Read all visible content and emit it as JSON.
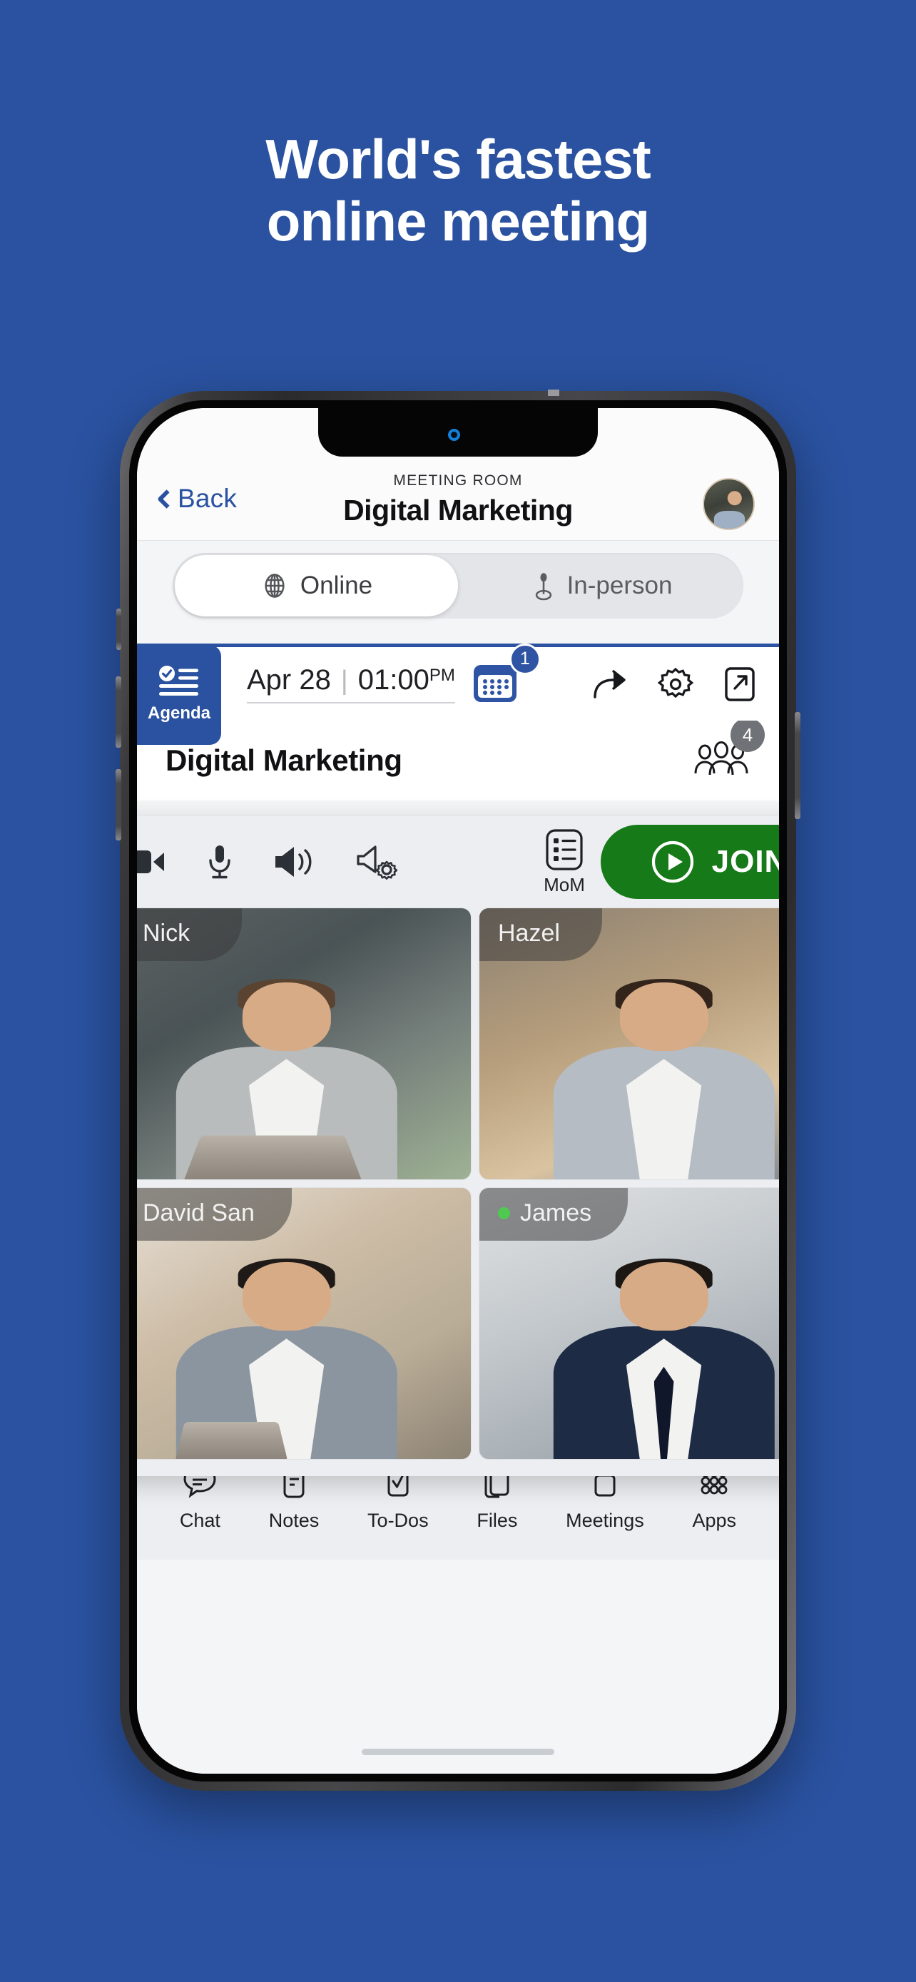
{
  "theme": {
    "background": "#2a52a0",
    "brand_blue": "#2a52a0",
    "join_green": "#167a18",
    "online_dot": "#4fc94f",
    "badge_grey": "#6f7277"
  },
  "promo": {
    "headline_line1": "World's fastest",
    "headline_line2": "online meeting"
  },
  "app": {
    "header": {
      "back_label": "Back",
      "kicker": "MEETING ROOM",
      "title": "Digital Marketing",
      "avatar_name": "avatar"
    },
    "segmented": {
      "options": [
        {
          "label": "Online",
          "icon": "globe-icon",
          "active": true
        },
        {
          "label": "In-person",
          "icon": "map-pin-icon",
          "active": false
        }
      ]
    },
    "agenda": {
      "tab_label": "Agenda",
      "date": "Apr 28",
      "separator": "|",
      "time": "01:00",
      "ampm": "PM",
      "calendar_badge": "1",
      "actions": [
        {
          "name": "share-icon"
        },
        {
          "name": "gear-icon"
        },
        {
          "name": "expand-icon"
        }
      ]
    },
    "meeting": {
      "title": "Digital Marketing",
      "participants_badge": "4"
    },
    "call_card": {
      "controls": [
        {
          "name": "video-camera-icon"
        },
        {
          "name": "microphone-icon"
        },
        {
          "name": "speaker-icon"
        },
        {
          "name": "speaker-settings-icon"
        }
      ],
      "mom_label": "MoM",
      "join_label": "JOIN",
      "tiles": [
        {
          "name": "Nick",
          "online": true
        },
        {
          "name": "Hazel",
          "online": false
        },
        {
          "name": "David San",
          "online": true
        },
        {
          "name": "James",
          "online": true
        }
      ]
    },
    "bottom_nav": [
      {
        "label": "Chat",
        "icon": "chat-bubble-icon"
      },
      {
        "label": "Notes",
        "icon": "notes-icon"
      },
      {
        "label": "To-Dos",
        "icon": "checkbox-icon"
      },
      {
        "label": "Files",
        "icon": "files-icon"
      },
      {
        "label": "Meetings",
        "icon": "meetings-icon"
      },
      {
        "label": "Apps",
        "icon": "apps-grid-icon"
      }
    ]
  }
}
